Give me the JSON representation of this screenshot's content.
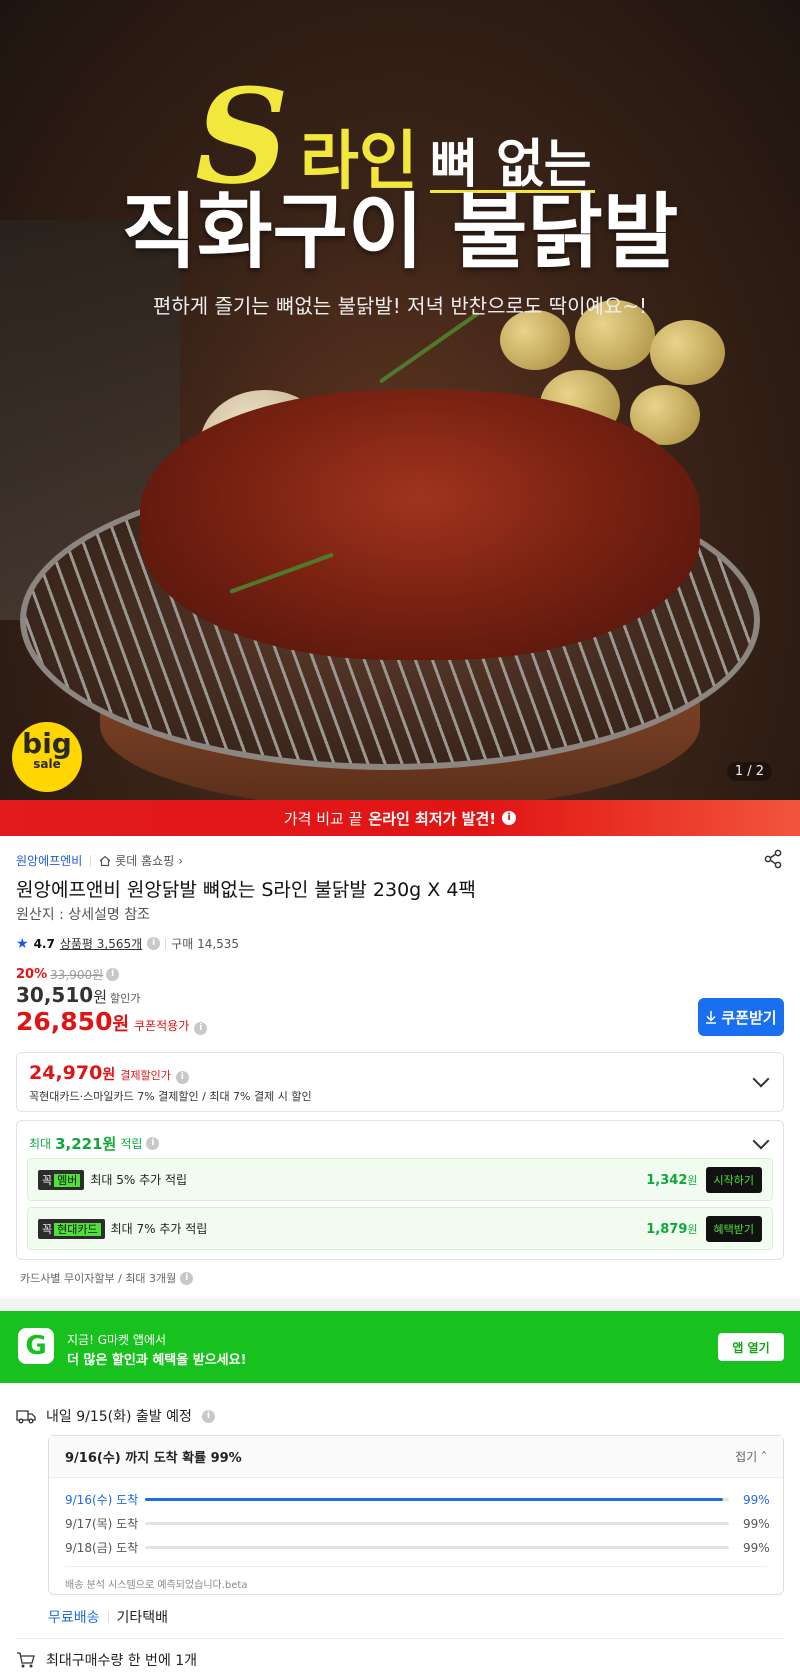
{
  "hero": {
    "s_letter": "S",
    "title_part1": "라인",
    "title_part2": "뼈 없는",
    "title_line2": "직화구이 불닭발",
    "subtitle": "편하게 즐기는 뼈없는 불닭발! 저녁 반찬으로도 딱이예요~!",
    "badge_line1": "big",
    "badge_line2": "sale",
    "pager": "1 / 2"
  },
  "banner": {
    "prefix": "가격 비교 끝",
    "highlight": "온라인 최저가 발견!",
    "info": "i"
  },
  "product": {
    "seller": "원앙에프엔비",
    "shop": "롯데 홈쇼핑",
    "shop_arrow": "›",
    "title": "원앙에프앤비 원앙닭발 뼈없는 S라인 불닭발 230g X 4팩",
    "origin": "원산지 : 상세설명 참조",
    "rating": "4.7",
    "reviews": "상품평 3,565개",
    "purchases": "구매 14,535"
  },
  "price": {
    "discount_pct": "20%",
    "original": "33,900원",
    "sale_price": "30,510",
    "sale_unit": "원",
    "sale_tag": "할인가",
    "coupon_price": "26,850",
    "coupon_unit": "원",
    "coupon_tag": "쿠폰적용가",
    "coupon_button": "쿠폰받기"
  },
  "payment": {
    "price": "24,970",
    "unit": "원",
    "tag": "결제할인가",
    "desc": "꼭현대카드·스마일카드 7% 결제할인 / 최대 7% 결제 시 할인"
  },
  "points": {
    "prefix": "최대",
    "amount": "3,221원",
    "suffix": "적립",
    "rows": [
      {
        "badge": "꼭",
        "badge_em": "멤버",
        "text": "최대 5% 추가 적립",
        "amount": "1,342",
        "unit": "원",
        "button": "시작하기"
      },
      {
        "badge": "꼭",
        "badge_em": "현대카드",
        "text": "최대 7% 추가 적립",
        "amount": "1,879",
        "unit": "원",
        "button": "혜택받기"
      }
    ]
  },
  "installment": "카드사별 무이자할부 / 최대 3개월",
  "app_banner": {
    "logo": "G",
    "line1": "지금! G마켓 앱에서",
    "line2": "더 많은 할인과 혜택을 받으세요!",
    "button": "앱 열기"
  },
  "shipping": {
    "departure": "내일 9/15(화) 출발 예정",
    "eta_title": "9/16(수) 까지 도착 확률 99%",
    "fold": "접기",
    "rows": [
      {
        "date": "9/16(수) 도착",
        "pct": "99%",
        "fill": 0.99,
        "active": true
      },
      {
        "date": "9/17(목) 도착",
        "pct": "99%",
        "fill": 0,
        "active": false
      },
      {
        "date": "9/18(금) 도착",
        "pct": "99%",
        "fill": 0,
        "active": false
      }
    ],
    "note": "배송 분석 시스템으로 예측되었습니다.beta",
    "free": "무료배송",
    "courier": "기타택배",
    "max_qty": "최대구매수량 한 번에 1개"
  },
  "colors": {
    "accent_blue": "#1a6ff0",
    "price_red": "#e11414",
    "gmarket_green": "#17c11e"
  }
}
